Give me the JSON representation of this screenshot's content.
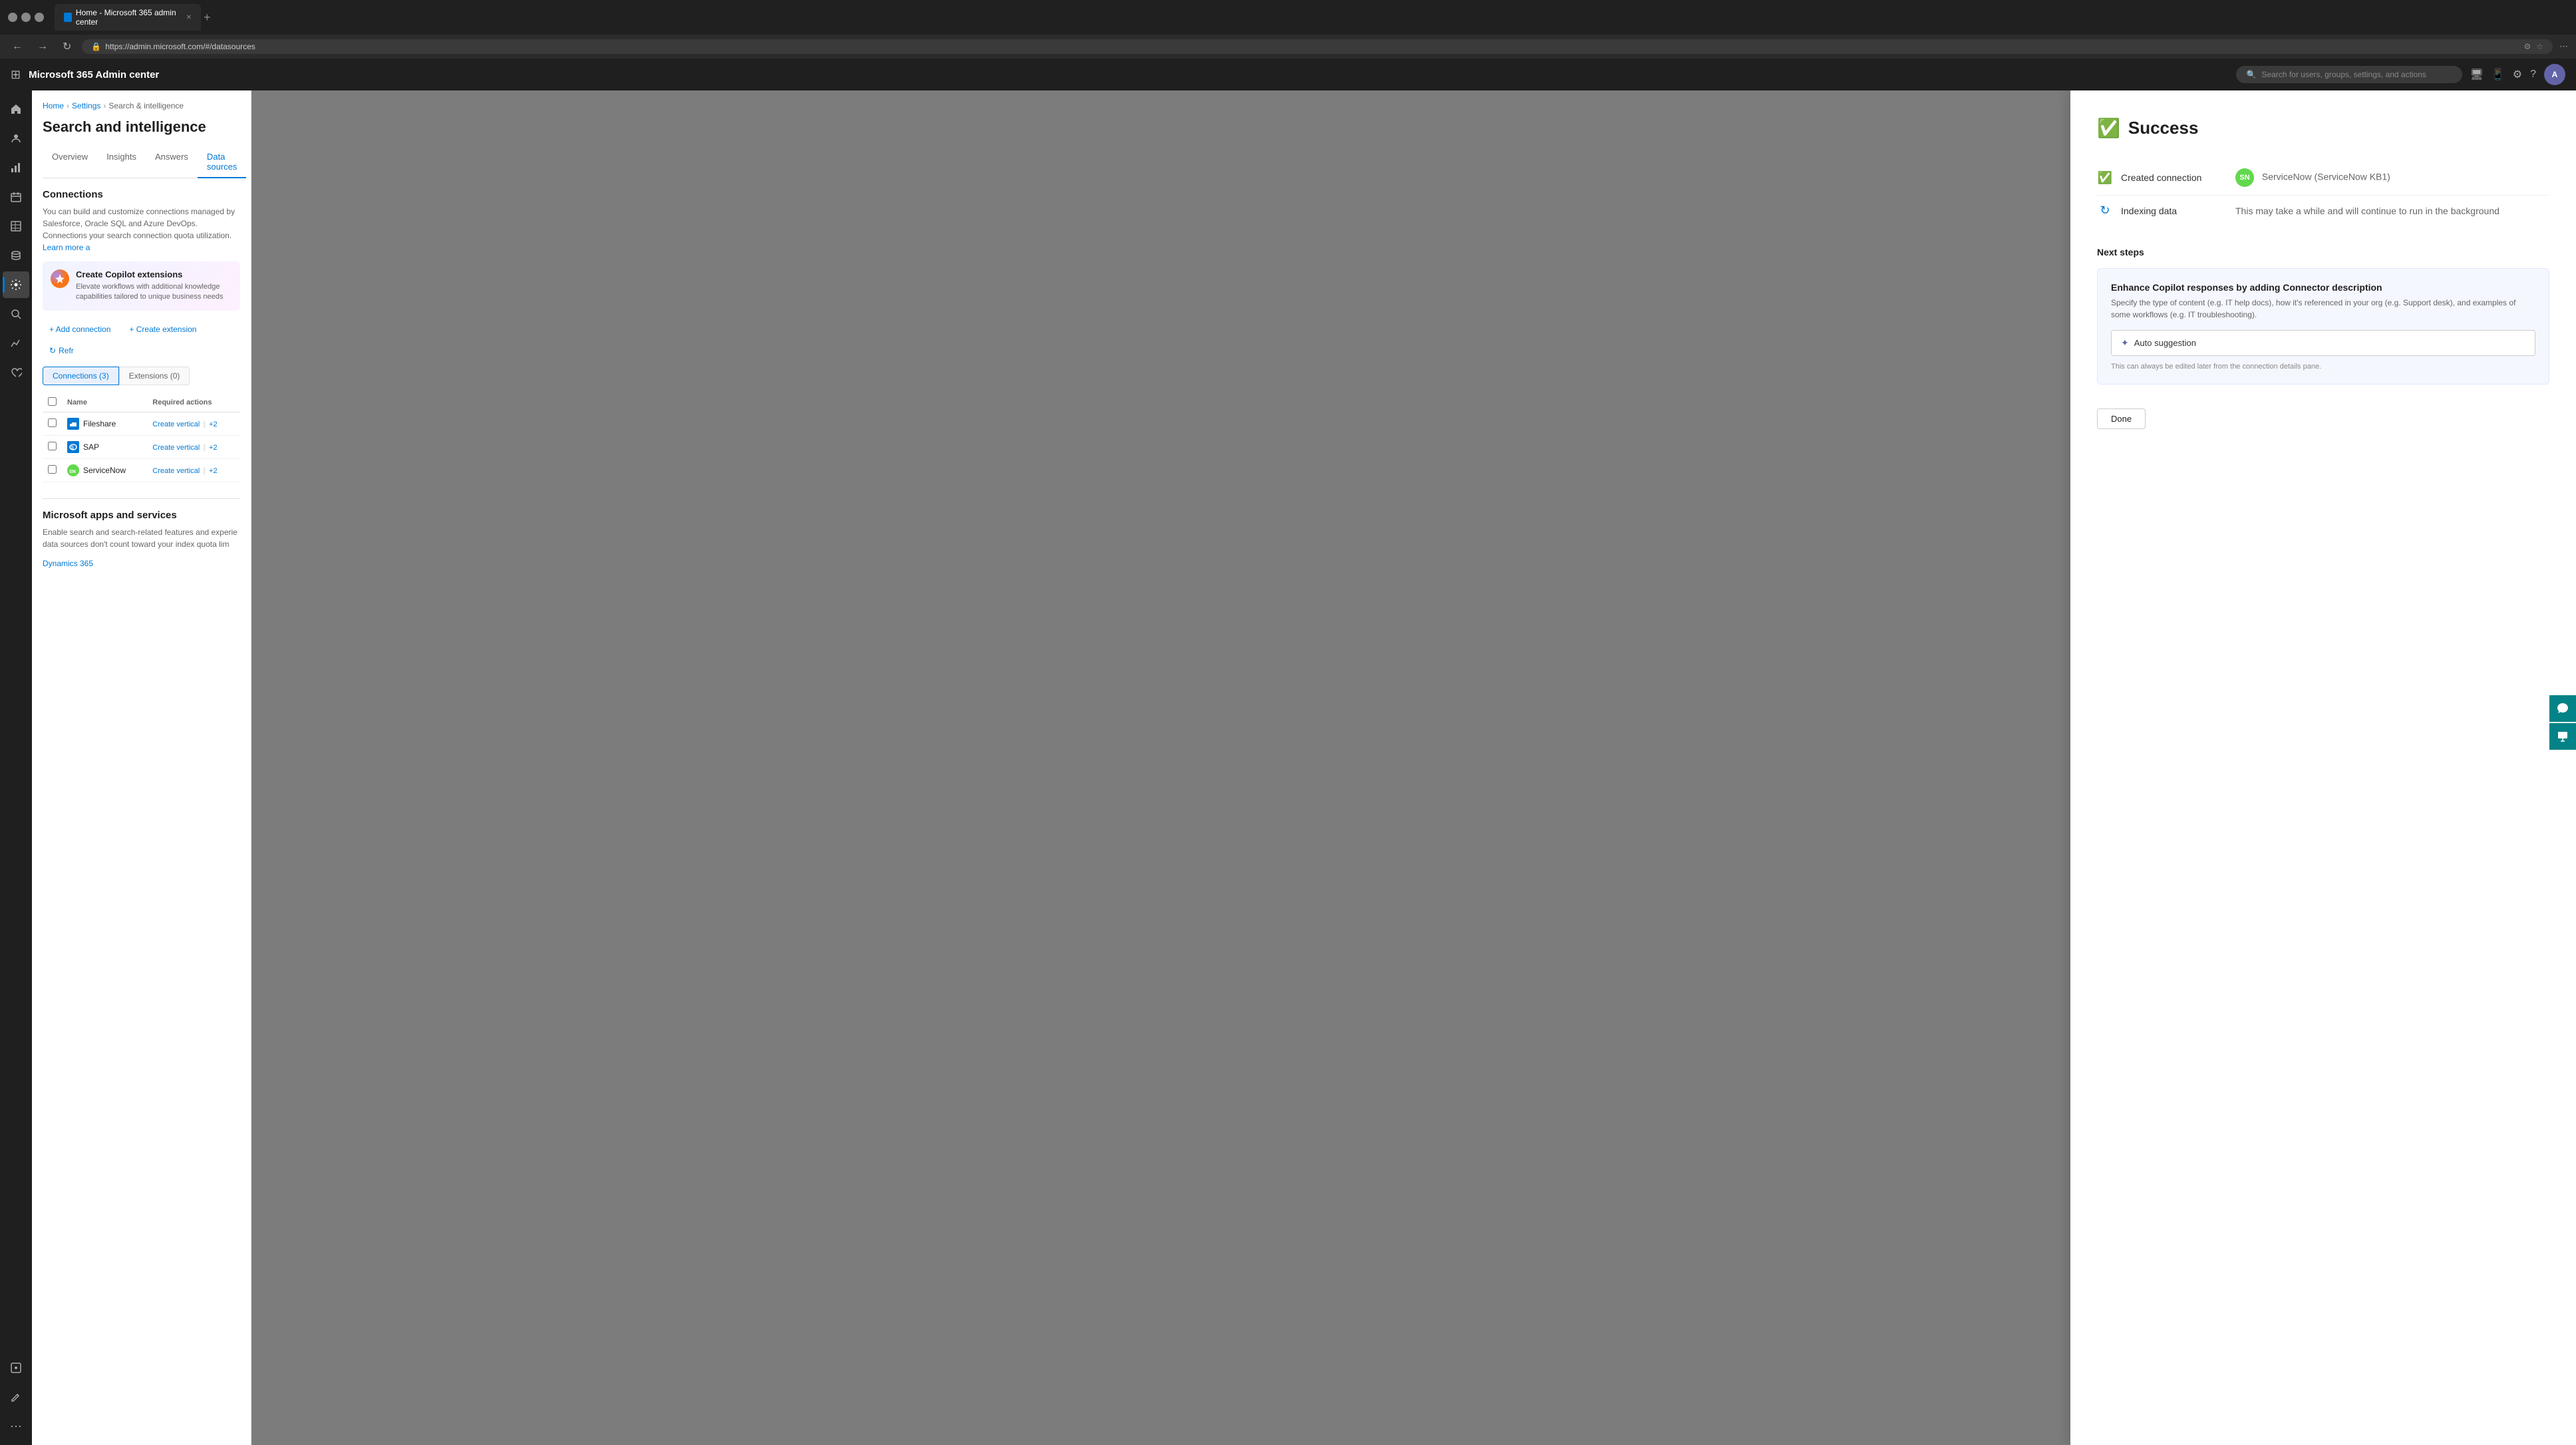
{
  "browser": {
    "tab_title": "Home - Microsoft 365 admin center",
    "address": "https://admin.microsoft.com/#/datasources",
    "favicon": "M"
  },
  "topnav": {
    "title": "Microsoft 365 Admin center",
    "search_placeholder": "Search for users, groups, settings, and actions",
    "avatar_initials": "A"
  },
  "breadcrumb": {
    "home": "Home",
    "settings": "Settings",
    "search_intelligence": "Search & intelligence"
  },
  "page": {
    "title": "Search and intelligence"
  },
  "tabs": [
    {
      "label": "Overview",
      "active": false
    },
    {
      "label": "Insights",
      "active": false
    },
    {
      "label": "Answers",
      "active": false
    },
    {
      "label": "Data sources",
      "active": true
    }
  ],
  "connections_section": {
    "title": "Connections",
    "desc": "You can build and customize connections managed by Salesforce, Oracle SQL and Azure DevOps. Connections your search connection quota utilization.",
    "learn_more": "Learn more a"
  },
  "copilot_banner": {
    "title": "Create Copilot extensions",
    "desc": "Elevate workflows with additional knowledge capabilities tailored to unique business needs"
  },
  "action_bar": {
    "add_connection": "+ Add connection",
    "create_extension": "+ Create extension",
    "refresh": "Refr"
  },
  "sub_tabs": [
    {
      "label": "Connections (3)",
      "active": true
    },
    {
      "label": "Extensions (0)",
      "active": false
    }
  ],
  "table": {
    "columns": [
      "Name",
      "Required actions"
    ],
    "rows": [
      {
        "name": "Fileshare",
        "icon_color": "#0078d4",
        "icon_letter": "F",
        "action": "Create vertical",
        "action2": "+2"
      },
      {
        "name": "SAP",
        "icon_color": "#0078d4",
        "icon_letter": "S",
        "action": "Create vertical",
        "action2": "+2"
      },
      {
        "name": "ServiceNow",
        "icon_color": "#62d84e",
        "icon_letter": "SN",
        "action": "Create vertical",
        "action2": "+2"
      }
    ]
  },
  "ms_apps": {
    "title": "Microsoft apps and services",
    "desc": "Enable search and search-related features and experie data sources don't count toward your index quota lim",
    "dynamics_link": "Dynamics 365"
  },
  "modal": {
    "success_title": "Success",
    "progress_items": [
      {
        "status": "done",
        "label": "Created connection",
        "value": "ServiceNow (ServiceNow KB1)"
      },
      {
        "status": "spinning",
        "label": "Indexing data",
        "value": "This may take a while and will continue to run in the background"
      }
    ],
    "next_steps_label": "Next steps",
    "enhance_card": {
      "title": "Enhance Copilot responses by adding Connector description",
      "desc": "Specify the type of content (e.g. IT help docs), how it's referenced in your org (e.g. Support desk), and examples of some workflows (e.g. IT troubleshooting).",
      "auto_suggestion_label": "Auto suggestion",
      "edit_note": "This can always be edited later from the connection details pane."
    },
    "done_btn": "Done"
  }
}
